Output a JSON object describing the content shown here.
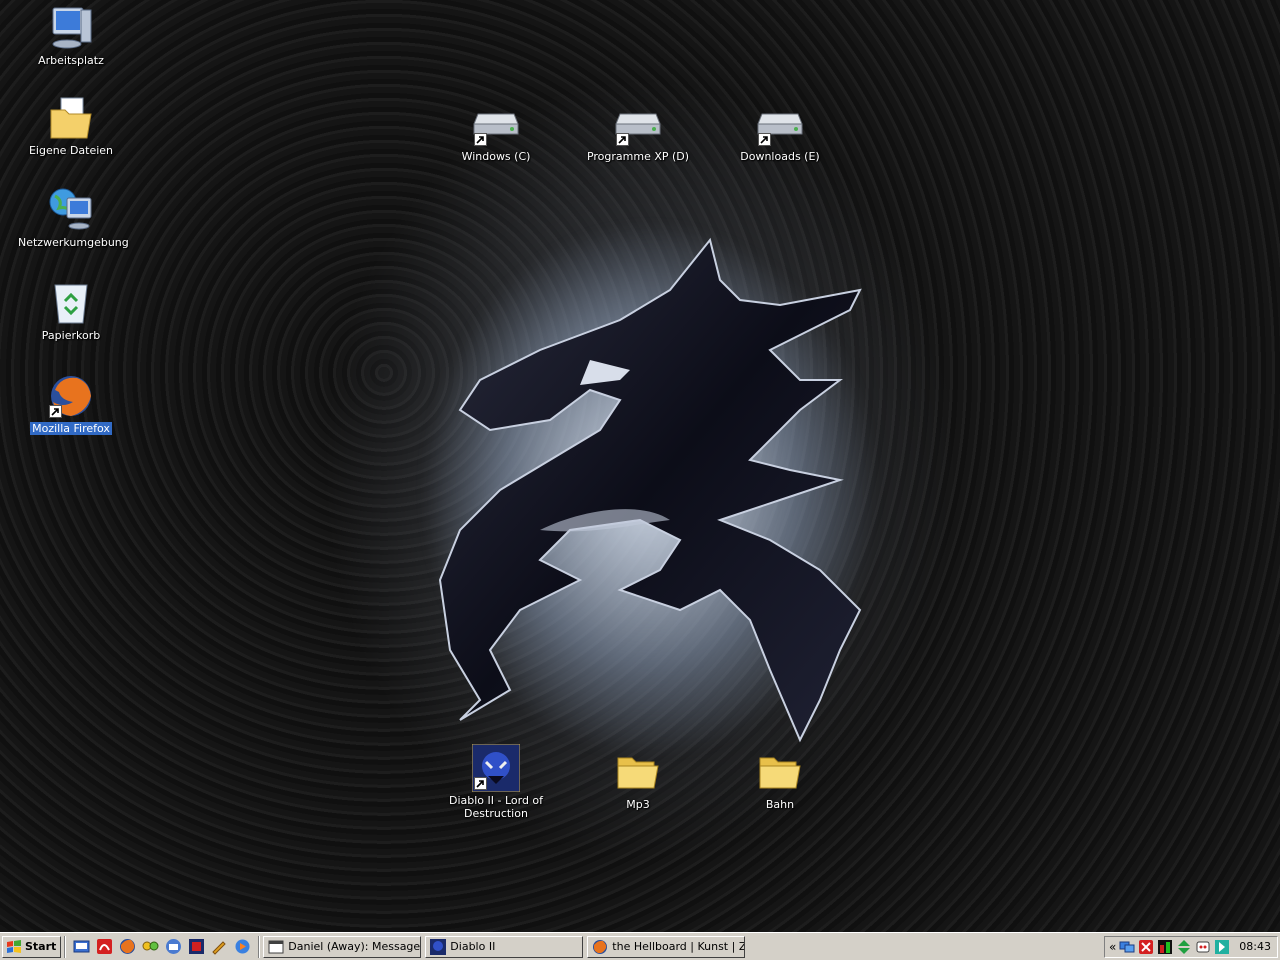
{
  "desktop": {
    "left_icons": [
      {
        "label": "Arbeitsplatz",
        "icon": "my-computer-icon"
      },
      {
        "label": "Eigene Dateien",
        "icon": "my-documents-icon"
      },
      {
        "label": "Netzwerkumgebung",
        "icon": "network-icon"
      },
      {
        "label": "Papierkorb",
        "icon": "recycle-bin-icon"
      },
      {
        "label": "Mozilla Firefox",
        "icon": "firefox-icon"
      }
    ],
    "drive_icons": [
      {
        "label": "Windows (C)",
        "icon": "hard-drive-icon"
      },
      {
        "label": "Programme XP (D)",
        "icon": "hard-drive-icon"
      },
      {
        "label": "Downloads (E)",
        "icon": "hard-drive-icon"
      }
    ],
    "bottom_icons": [
      {
        "label": "Diablo II - Lord of Destruction",
        "icon": "diablo-icon"
      },
      {
        "label": "Mp3",
        "icon": "folder-icon"
      },
      {
        "label": "Bahn",
        "icon": "folder-icon"
      }
    ]
  },
  "taskbar": {
    "start_label": "Start",
    "tasks": [
      {
        "label": "Daniel (Away): Message ..."
      },
      {
        "label": "Diablo II"
      },
      {
        "label": "the Hellboard | Kunst | Z..."
      }
    ],
    "tray_expand": "«",
    "clock": "08:43"
  }
}
